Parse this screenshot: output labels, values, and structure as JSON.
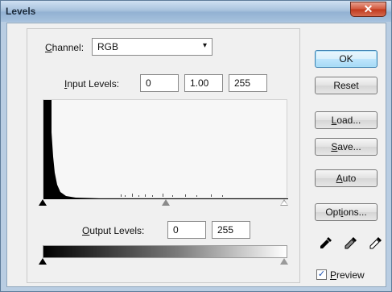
{
  "window": {
    "title": "Levels",
    "close_glyph": "✕"
  },
  "channel": {
    "label_prefix": "",
    "label_u": "C",
    "label_rest": "hannel:",
    "value": "RGB",
    "arrow": "▾"
  },
  "input_levels": {
    "label_u": "I",
    "label_rest": "nput Levels:",
    "black": "0",
    "gamma": "1.00",
    "white": "255"
  },
  "output_levels": {
    "label_u": "O",
    "label_rest": "utput Levels:",
    "black": "0",
    "white": "255"
  },
  "buttons": {
    "ok": "OK",
    "reset": "Reset",
    "load_u": "L",
    "load_rest": "oad...",
    "save_u": "S",
    "save_rest": "ave...",
    "auto_u": "A",
    "auto_rest": "uto",
    "options_pre": "Opt",
    "options_u": "i",
    "options_rest": "ons..."
  },
  "preview": {
    "checked_glyph": "✓",
    "label_u": "P",
    "label_rest": "review",
    "checked": true
  },
  "eyedroppers": [
    "black-eyedropper-icon",
    "gray-eyedropper-icon",
    "white-eyedropper-icon"
  ],
  "colors": {
    "accent": "#3c7fb1",
    "titlebar": "#a9c3de",
    "close": "#c0381c"
  }
}
